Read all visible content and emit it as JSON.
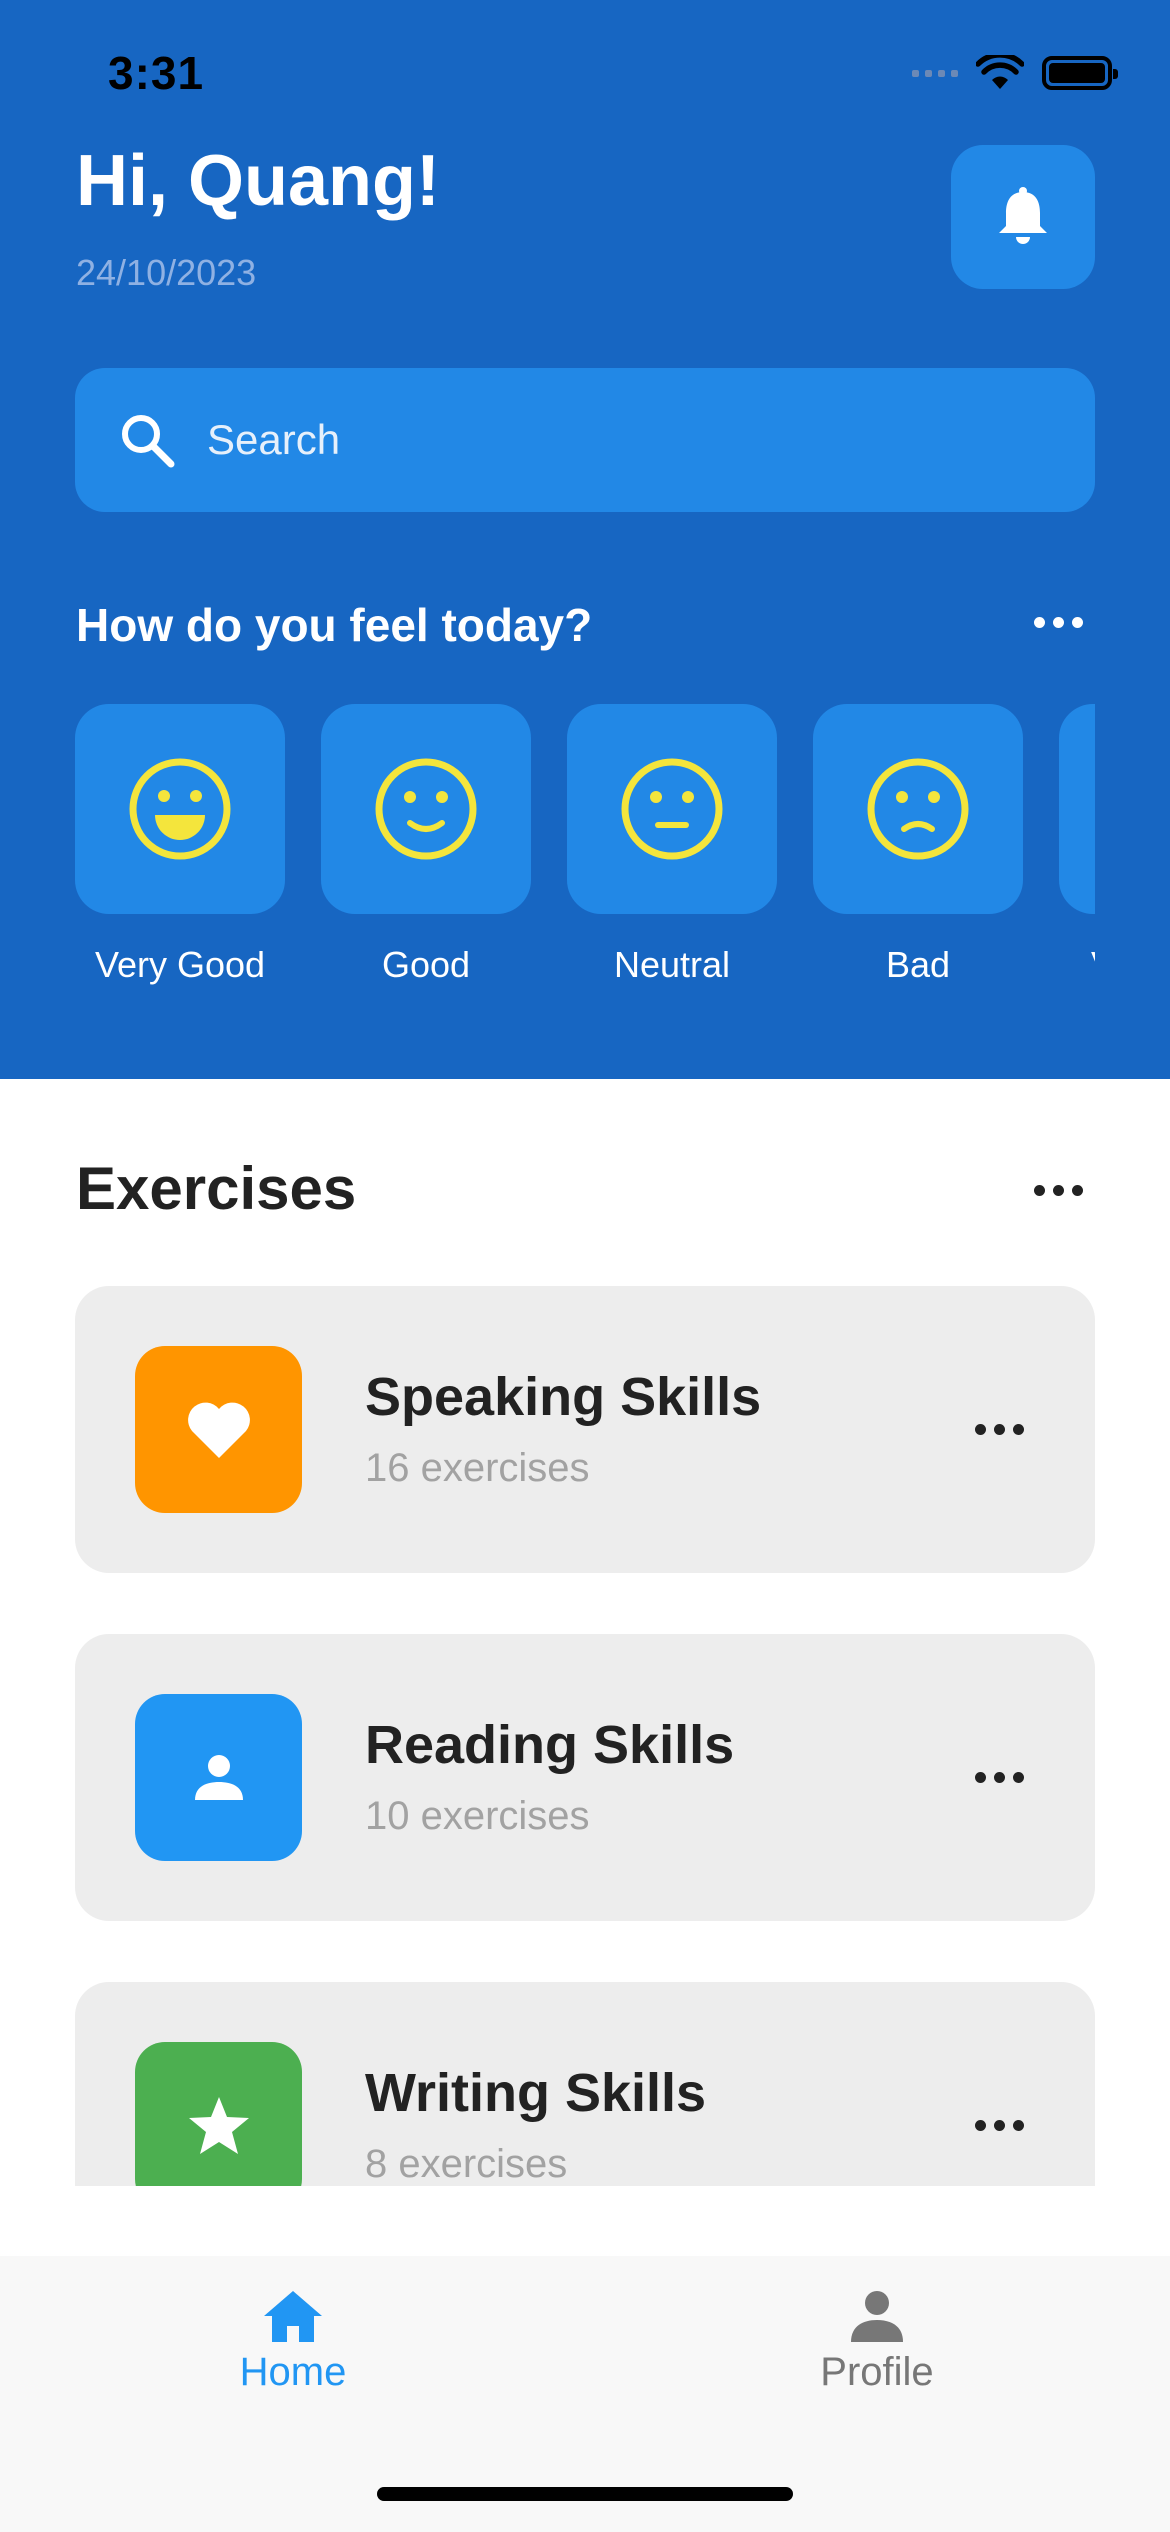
{
  "status_bar": {
    "time": "3:31"
  },
  "header": {
    "greeting": "Hi, Quang!",
    "date": "24/10/2023",
    "bell_icon": "bell-icon"
  },
  "search": {
    "placeholder": "Search",
    "icon": "search-icon"
  },
  "mood_section": {
    "title": "How do you feel today?",
    "moods": [
      {
        "label": "Very Good",
        "icon": "very-happy-face-icon"
      },
      {
        "label": "Good",
        "icon": "happy-face-icon"
      },
      {
        "label": "Neutral",
        "icon": "neutral-face-icon"
      },
      {
        "label": "Bad",
        "icon": "sad-face-icon"
      },
      {
        "label": "Very Bad",
        "icon": "very-sad-face-icon"
      }
    ]
  },
  "exercises": {
    "title": "Exercises",
    "items": [
      {
        "title": "Speaking Skills",
        "subtitle": "16 exercises",
        "icon": "heart-icon",
        "color": "#ff9500"
      },
      {
        "title": "Reading Skills",
        "subtitle": "10 exercises",
        "icon": "person-icon",
        "color": "#2196f3"
      },
      {
        "title": "Writing Skills",
        "subtitle": "8 exercises",
        "icon": "star-icon",
        "color": "#4caf50"
      }
    ]
  },
  "bottom_nav": {
    "items": [
      {
        "label": "Home",
        "icon": "home-icon",
        "active": true
      },
      {
        "label": "Profile",
        "icon": "profile-icon",
        "active": false
      }
    ]
  },
  "colors": {
    "header_bg": "#1766c2",
    "tile_bg": "#2288e6",
    "face": "#f4e53c",
    "active_nav": "#2196f3",
    "inactive_nav": "#777777"
  }
}
